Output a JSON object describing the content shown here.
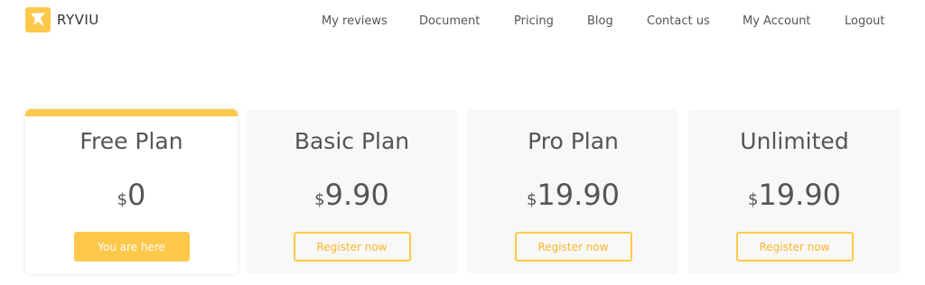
{
  "brand": {
    "name": "RYVIU",
    "accent_color": "#fec84b"
  },
  "nav": {
    "items": [
      {
        "label": "My reviews"
      },
      {
        "label": "Document"
      },
      {
        "label": "Pricing"
      },
      {
        "label": "Blog"
      },
      {
        "label": "Contact us"
      },
      {
        "label": "My Account"
      },
      {
        "label": "Logout"
      }
    ]
  },
  "plans": [
    {
      "name": "Free Plan",
      "currency": "$",
      "price": "0",
      "button": "You are here",
      "current": true
    },
    {
      "name": "Basic Plan",
      "currency": "$",
      "price": "9.90",
      "button": "Register now",
      "current": false
    },
    {
      "name": "Pro Plan",
      "currency": "$",
      "price": "19.90",
      "button": "Register now",
      "current": false
    },
    {
      "name": "Unlimited",
      "currency": "$",
      "price": "19.90",
      "button": "Register now",
      "current": false
    }
  ]
}
